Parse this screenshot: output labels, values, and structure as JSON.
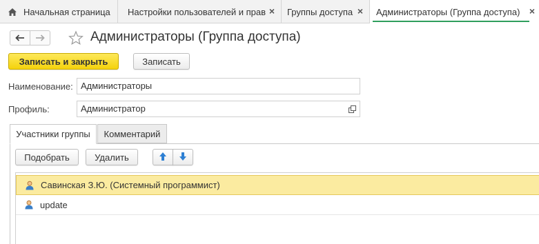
{
  "tabs": {
    "home": {
      "label": "Начальная страница",
      "icon": "home-icon"
    },
    "settings": {
      "label": "Настройки пользователей и прав",
      "close": "×"
    },
    "groups": {
      "label": "Группы доступа",
      "close": "×"
    },
    "admins": {
      "label": "Администраторы (Группа доступа)",
      "close": "×"
    }
  },
  "header": {
    "title": "Администраторы (Группа доступа)",
    "back_icon": "arrow-left-icon",
    "forward_icon": "arrow-right-icon",
    "favorite_icon": "star-icon"
  },
  "toolbar": {
    "save_close_label": "Записать и закрыть",
    "save_label": "Записать"
  },
  "form": {
    "name_label": "Наименование:",
    "name_value": "Администраторы",
    "profile_label": "Профиль:",
    "profile_value": "Администратор"
  },
  "panel_tabs": {
    "members": "Участники группы",
    "comment": "Комментарий"
  },
  "list_toolbar": {
    "pick_label": "Подобрать",
    "delete_label": "Удалить",
    "move_up_icon": "arrow-up-icon",
    "move_down_icon": "arrow-down-icon"
  },
  "members": [
    {
      "label": "Савинская З.Ю. (Системный программист)",
      "icon": "user-icon",
      "selected": true
    },
    {
      "label": "update",
      "icon": "user-icon",
      "selected": false
    }
  ],
  "colors": {
    "primary_button": "#f5d30c",
    "active_tab_underline": "#2f9e5c",
    "selected_row": "#fbeba0",
    "arrow_blue": "#2d7fd3"
  }
}
